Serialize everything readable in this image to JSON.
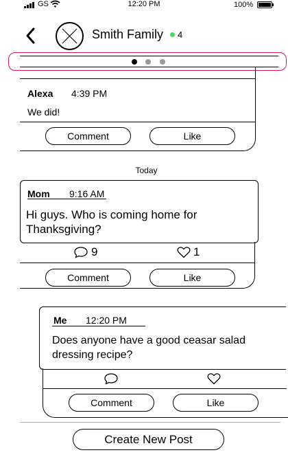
{
  "status_bar": {
    "carrier": "GS",
    "time": "12:20 PM",
    "battery": "100%"
  },
  "header": {
    "title": "Smith Family",
    "online_count": "4",
    "online_color": "#4cd964"
  },
  "carousel": {
    "dots": [
      {
        "active": true
      },
      {
        "active": false
      },
      {
        "active": false
      }
    ],
    "highlight_color": "#d01a5d"
  },
  "posts": [
    {
      "author": "Alexa",
      "time": "4:39 PM",
      "text": "We did!",
      "comment_label": "Comment",
      "like_label": "Like"
    },
    {
      "date_separator": "Today",
      "author": "Mom",
      "time": "9:16 AM",
      "text_line1": "Hi guys. Who is coming home for",
      "text_line2": "Thanksgiving?",
      "comment_count": "9",
      "like_count": "1",
      "comment_label": "Comment",
      "like_label": "Like"
    },
    {
      "author": "Me",
      "time": "12:20 PM",
      "text_line1": "Does anyone have a good ceasar salad",
      "text_line2": "dressing recipe?",
      "comment_label": "Comment",
      "like_label": "Like"
    }
  ],
  "footer": {
    "create_label": "Create New Post"
  }
}
